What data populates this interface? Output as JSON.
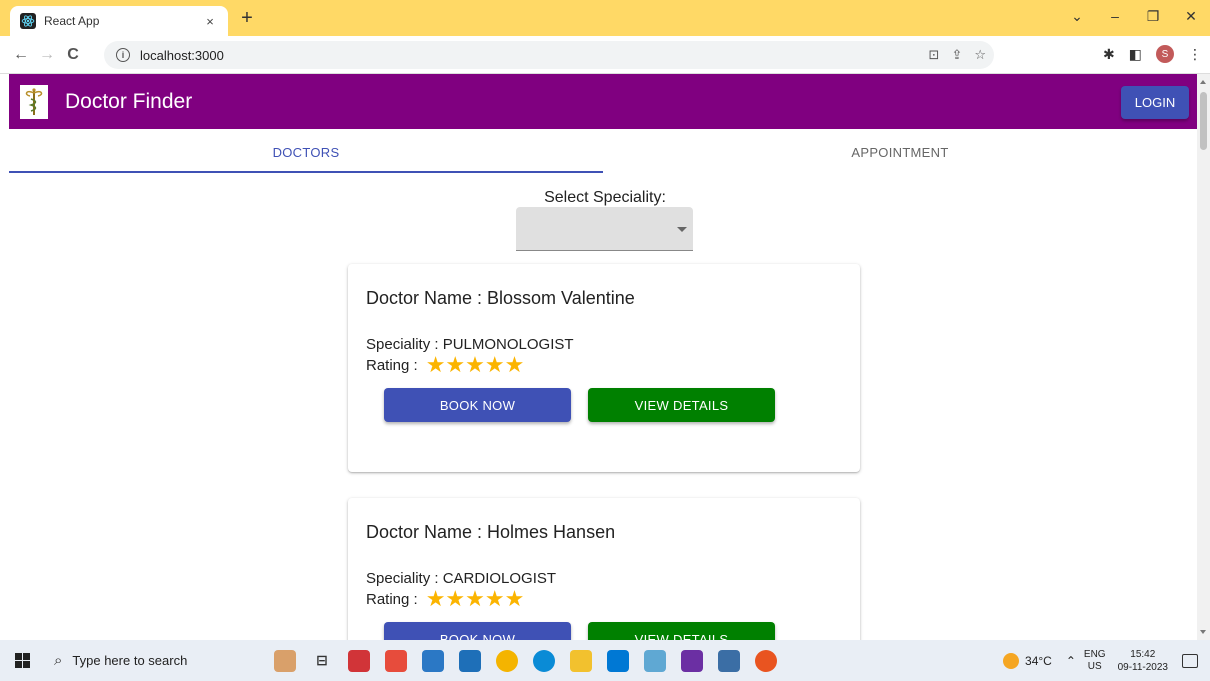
{
  "browser": {
    "tab_title": "React App",
    "tab_close": "×",
    "new_tab": "+",
    "url": "localhost:3000",
    "avatar_letter": "S",
    "window_controls": [
      "⌄",
      "–",
      "❐",
      "✕"
    ]
  },
  "app": {
    "title": "Doctor Finder",
    "login_label": "LOGIN",
    "brand_color": "#800080",
    "primary_color": "#3f51b5",
    "success_color": "#008000"
  },
  "tabs": [
    {
      "label": "DOCTORS",
      "active": true
    },
    {
      "label": "APPOINTMENT",
      "active": false
    }
  ],
  "filter": {
    "label": "Select Speciality:",
    "selected_value": ""
  },
  "doctors": [
    {
      "name": "Doctor Name : Blossom Valentine",
      "speciality": "Speciality : PULMONOLOGIST",
      "rating_label": "Rating :",
      "stars": "★★★★★",
      "rating": 5,
      "book_label": "BOOK NOW",
      "details_label": "VIEW DETAILS"
    },
    {
      "name": "Doctor Name : Holmes Hansen",
      "speciality": "Speciality : CARDIOLOGIST",
      "rating_label": "Rating :",
      "stars": "★★★★★",
      "rating": 5,
      "book_label": "BOOK NOW",
      "details_label": "VIEW DETAILS"
    }
  ],
  "taskbar": {
    "search_placeholder": "Type here to search",
    "temperature": "34°C",
    "lang_top": "ENG",
    "lang_bottom": "US",
    "time": "15:42",
    "date": "09-11-2023"
  }
}
